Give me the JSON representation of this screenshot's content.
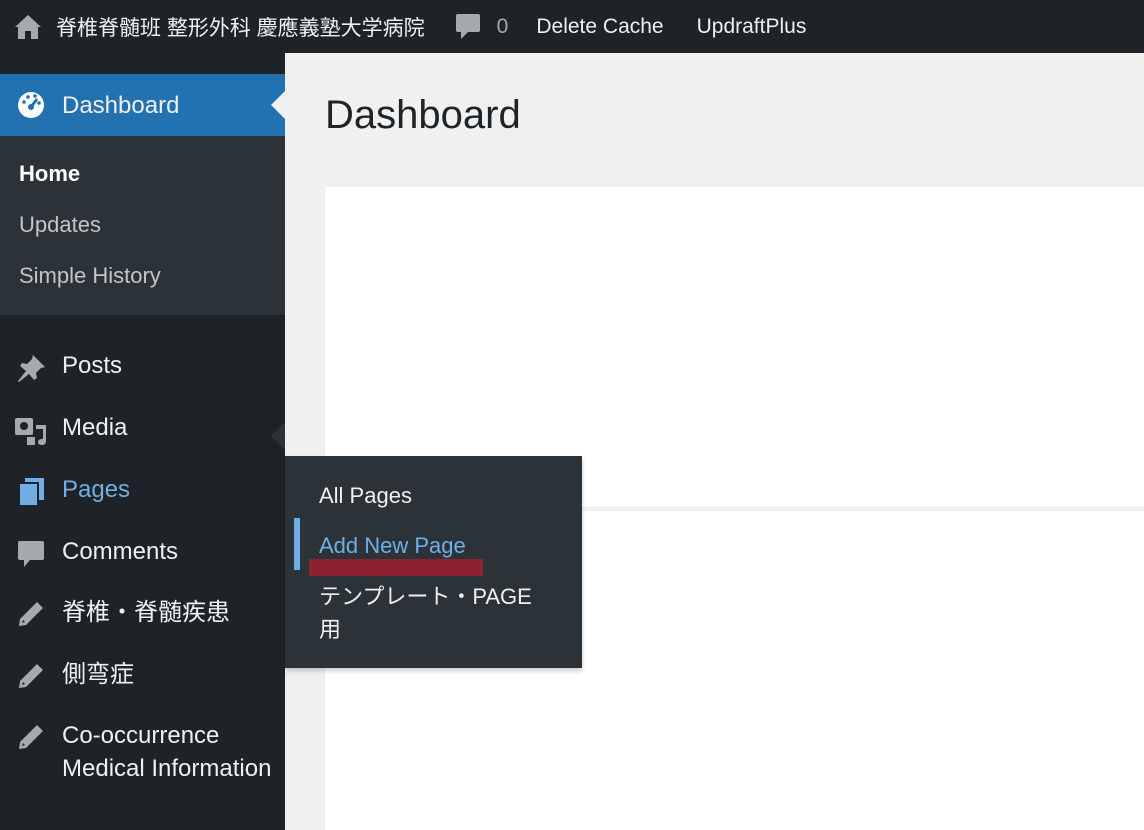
{
  "adminbar": {
    "site_title": "脊椎脊髄班 整形外科 慶應義塾大学病院",
    "comments_count": "0",
    "delete_cache": "Delete Cache",
    "updraftplus": "UpdraftPlus",
    "icons": [
      "home-icon",
      "comment-bubble-icon"
    ]
  },
  "sidebar": {
    "dashboard": "Dashboard",
    "submenu": [
      "Home",
      "Updates",
      "Simple History"
    ],
    "items": [
      {
        "label": "Posts",
        "icon": "pin-icon"
      },
      {
        "label": "Media",
        "icon": "media-icon"
      },
      {
        "label": "Pages",
        "icon": "pages-icon"
      },
      {
        "label": "Comments",
        "icon": "comment-icon"
      },
      {
        "label": "脊椎・脊髄疾患",
        "icon": "pencil-icon"
      },
      {
        "label": "側弯症",
        "icon": "pencil-icon"
      },
      {
        "label": "Co-occurrence Medical Information",
        "icon": "pencil-icon"
      }
    ]
  },
  "flyout": {
    "items": [
      "All Pages",
      "Add New Page",
      "テンプレート・PAGE用"
    ]
  },
  "main": {
    "title": "Dashboard"
  },
  "colors": {
    "adminbar_bg": "#1d2327",
    "accent": "#2271b1",
    "hover_text": "#72aee6",
    "highlight_mark": "#8c2130"
  }
}
